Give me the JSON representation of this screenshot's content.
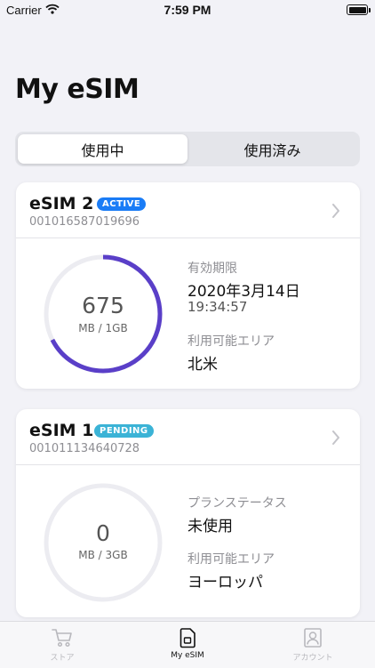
{
  "status_bar": {
    "carrier": "Carrier",
    "time": "7:59 PM"
  },
  "page_title": "My eSIM",
  "segments": [
    {
      "label": "使用中",
      "selected": true
    },
    {
      "label": "使用済み",
      "selected": false
    }
  ],
  "cards": [
    {
      "name": "eSIM 2",
      "badge": "ACTIVE",
      "badge_color": "#1a7cf6",
      "number": "001016587019696",
      "usage_value": "675",
      "usage_unit": "MB / 1GB",
      "ring_color": "#5a3fc8",
      "ring_fraction": 0.675,
      "info_label_1": "有効期限",
      "info_value_1": "2020年3月14日",
      "info_sub_1": "19:34:57",
      "info_label_2": "利用可能エリア",
      "info_value_2": "北米"
    },
    {
      "name": "eSIM 1",
      "badge": "PENDING",
      "badge_color": "#3bb3d6",
      "number": "001011134640728",
      "usage_value": "0",
      "usage_unit": "MB / 3GB",
      "ring_color": "#e8e8ee",
      "ring_fraction": 0,
      "info_label_1": "プランステータス",
      "info_value_1": "未使用",
      "info_label_2": "利用可能エリア",
      "info_value_2": "ヨーロッパ"
    }
  ],
  "tabs": [
    {
      "label": "ストア",
      "icon": "cart-icon",
      "active": false
    },
    {
      "label": "My eSIM",
      "icon": "sim-card-icon",
      "active": true
    },
    {
      "label": "アカウント",
      "icon": "account-icon",
      "active": false
    }
  ],
  "colors": {
    "tab_active": "#111111",
    "tab_inactive": "#b8b8bd"
  }
}
